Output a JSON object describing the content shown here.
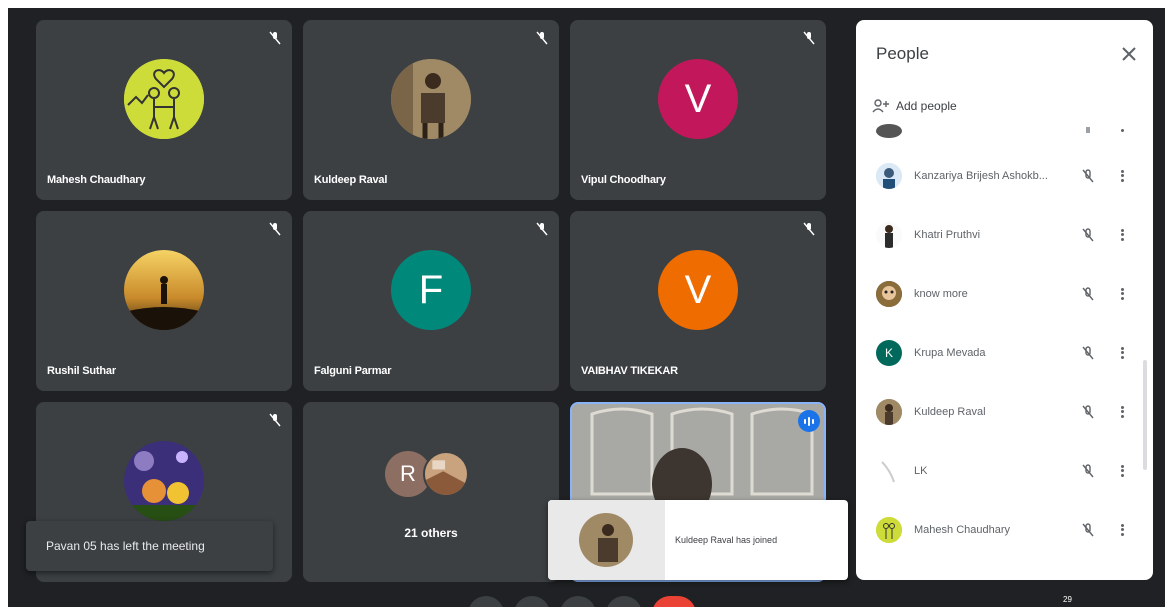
{
  "tiles": [
    {
      "name": "Mahesh Chaudhary",
      "avatar": "illustration-couple",
      "muted": true
    },
    {
      "name": "Kuldeep Raval",
      "avatar": "photo-person",
      "muted": true
    },
    {
      "name": "Vipul Choodhary",
      "avatar_letter": "V",
      "avatar_color": "#c2185b",
      "muted": true
    },
    {
      "name": "Rushil Suthar",
      "avatar": "photo-silhouette-sunset",
      "muted": true
    },
    {
      "name": "Falguni Parmar",
      "avatar_letter": "F",
      "avatar_color": "#00897b",
      "muted": true
    },
    {
      "name": "VAIBHAV TIKEKAR",
      "avatar_letter": "V",
      "avatar_color": "#ef6c00",
      "muted": true
    },
    {
      "name": "",
      "avatar": "cartoon-image",
      "muted": true
    },
    {
      "others_letter": "R",
      "others_label": "21 others"
    },
    {
      "self_view": true,
      "speaking": true
    }
  ],
  "toasts": {
    "left_message": "Pavan 05 has left the meeting",
    "join_message": "Kuldeep Raval has joined"
  },
  "panel": {
    "title": "People",
    "add_people_label": "Add people",
    "participants": [
      {
        "name": "",
        "avatar": "photo",
        "partial": true
      },
      {
        "name": "Kanzariya Brijesh Ashokb...",
        "avatar": "photo"
      },
      {
        "name": "Khatri Pruthvi",
        "avatar": "photo"
      },
      {
        "name": "know more",
        "avatar": "photo"
      },
      {
        "name": "Krupa Mevada",
        "avatar_letter": "K",
        "avatar_color": "#00695c"
      },
      {
        "name": "Kuldeep Raval",
        "avatar": "photo"
      },
      {
        "name": "LK",
        "avatar": "photo-light"
      },
      {
        "name": "Mahesh Chaudhary",
        "avatar": "illustration"
      }
    ]
  },
  "footer": {
    "people_count": "29"
  },
  "colors": {
    "background": "#202124",
    "tile": "#3c4043",
    "accent": "#1a73e8",
    "end_call": "#ea4335"
  }
}
